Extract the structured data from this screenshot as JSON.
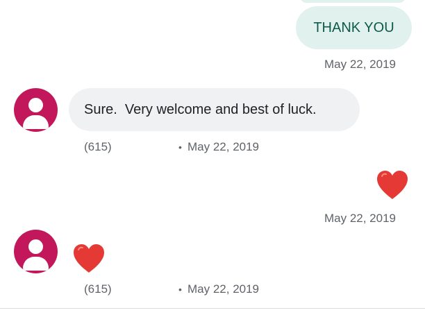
{
  "messages": [
    {
      "direction": "outgoing",
      "text": "THANK YOU",
      "timestamp": "May 22, 2019"
    },
    {
      "direction": "incoming",
      "text": "Sure.  Very welcome and best of luck.",
      "sender": "(615)",
      "separator": "•",
      "timestamp": "May 22, 2019"
    },
    {
      "direction": "outgoing",
      "icon": "heart-emoji-icon",
      "timestamp": "May 22, 2019"
    },
    {
      "direction": "incoming",
      "icon": "heart-emoji-icon",
      "sender": "(615)",
      "separator": "•",
      "timestamp": "May 22, 2019"
    }
  ],
  "colors": {
    "outgoing_bubble": "#e1f1ee",
    "outgoing_text": "#0d5a4a",
    "incoming_bubble": "#f0f1f3",
    "avatar": "#c2185b",
    "heart": "#e53935",
    "meta_text": "#5f6368"
  }
}
